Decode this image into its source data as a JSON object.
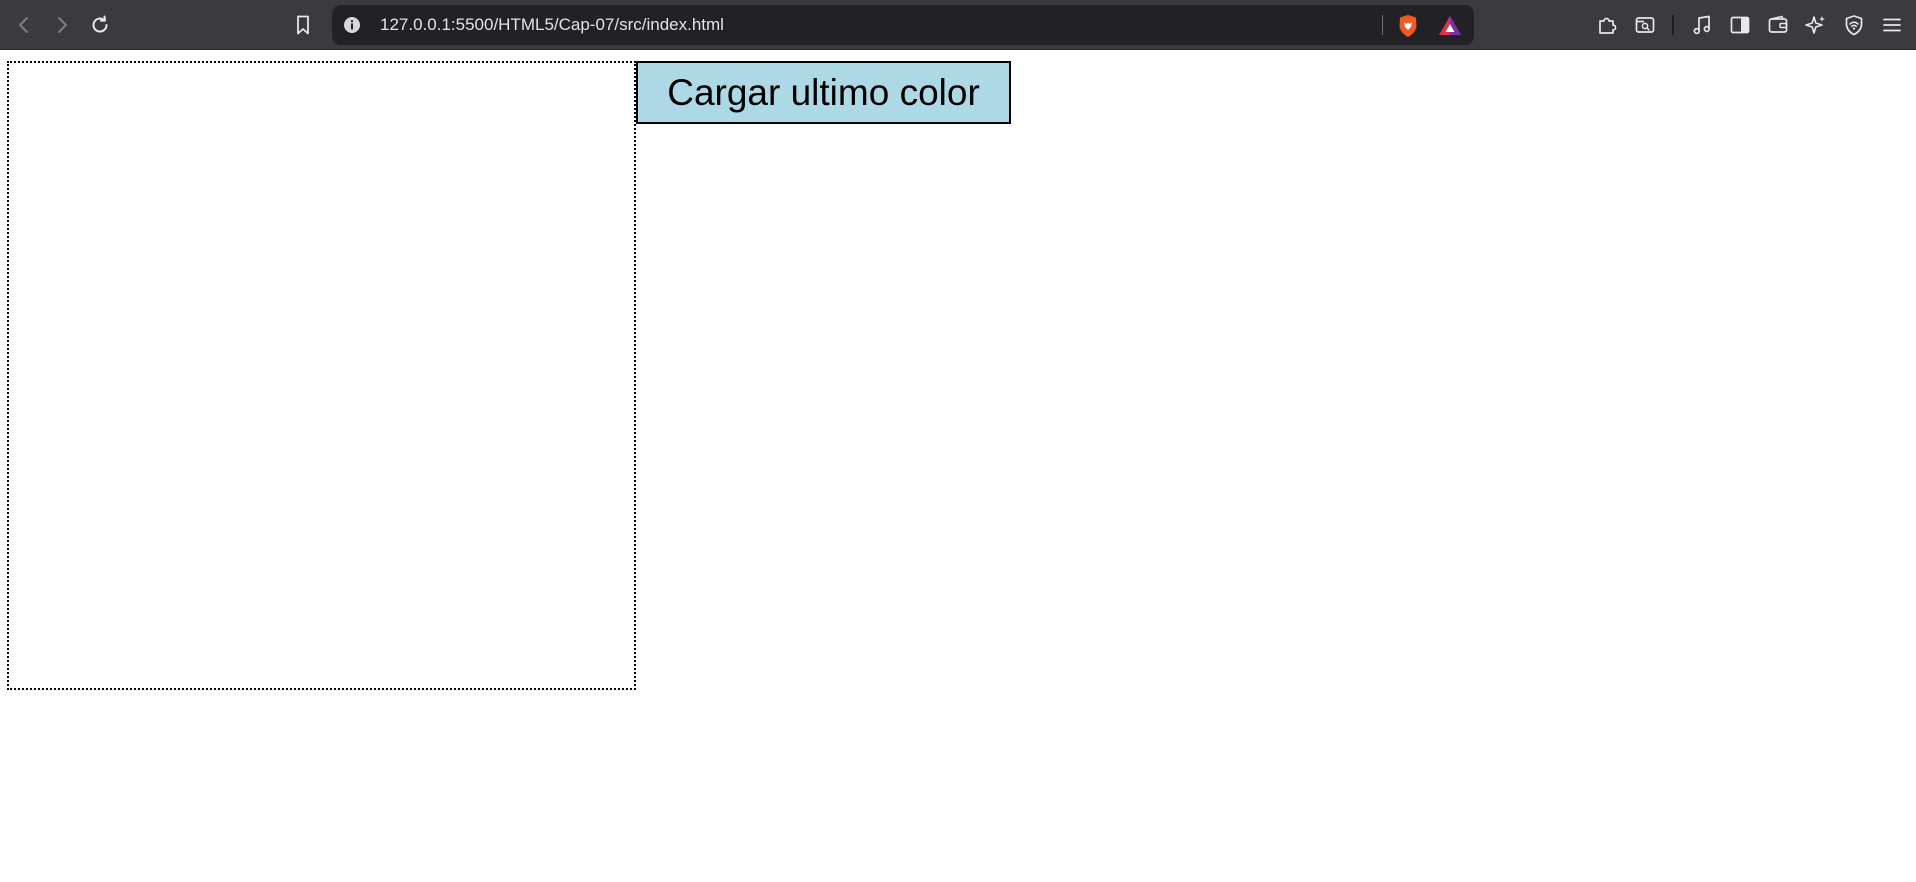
{
  "browser": {
    "url": "127.0.0.1:5500/HTML5/Cap-07/src/index.html",
    "icons": {
      "back": "back-arrow-icon",
      "forward": "forward-arrow-icon",
      "reload": "reload-icon",
      "bookmark": "bookmark-icon",
      "site_info": "info-icon",
      "brave_shield": "brave-shield-icon",
      "brave_rewards": "brave-rewards-icon",
      "extensions": "puzzle-icon",
      "search_tab": "tab-search-icon",
      "media": "music-note-icon",
      "sidebar": "sidebar-icon",
      "wallet": "wallet-icon",
      "leo": "sparkle-icon",
      "vpn": "vpn-shield-icon",
      "menu": "hamburger-menu-icon"
    },
    "colors": {
      "toolbar": "#3b3b3e",
      "urlbar": "#222226",
      "brave_orange": "#f25a23"
    }
  },
  "page": {
    "button_label": "Cargar ultimo color",
    "colors": {
      "button_bg": "#add8e6",
      "canvas_border": "#000000"
    }
  }
}
